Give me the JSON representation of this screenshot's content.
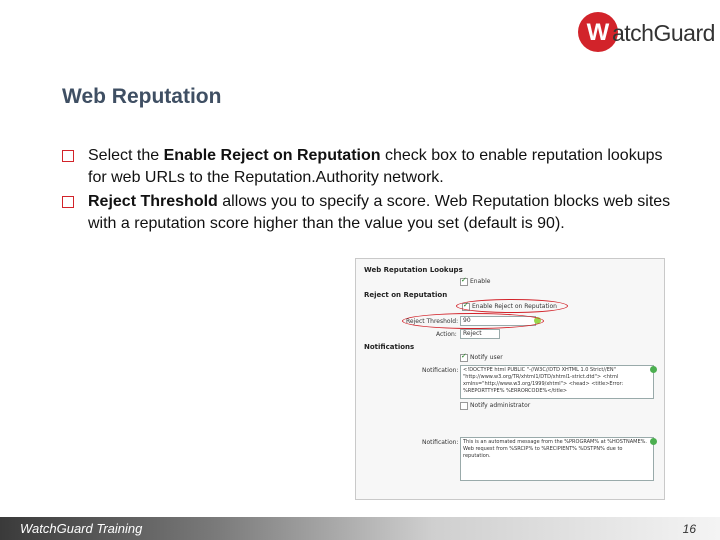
{
  "brand": {
    "logo_letter": "W",
    "logo_text": "atchGuard",
    "logo_color": "#d2232a"
  },
  "title": "Web Reputation",
  "bullets": [
    {
      "pre": "Select the ",
      "bold": "Enable Reject on Reputation",
      "post": " check box to enable reputation lookups for web URLs to the Reputation.Authority network."
    },
    {
      "pre": "",
      "bold": "Reject Threshold",
      "post": " allows you to specify a score. Web Reputation blocks web sites with a reputation score higher than the value you set (default is 90)."
    }
  ],
  "screenshot": {
    "section_lookups": "Web Reputation Lookups",
    "enable_label": "Enable",
    "section_reject": "Reject on Reputation",
    "enable_reject_label": "Enable Reject on Reputation",
    "threshold_label": "Reject Threshold:",
    "threshold_value": "90",
    "action_label": "Action:",
    "action_value": "Reject",
    "section_notifications": "Notifications",
    "notify_user_label": "Notify user",
    "notification_label": "Notification:",
    "notification_user_text": "<!DOCTYPE html PUBLIC \"-//W3C//DTD XHTML 1.0 Strict//EN\" \"http://www.w3.org/TR/xhtml1/DTD/xhtml1-strict.dtd\"> <html xmlns=\"http://www.w3.org/1999/xhtml\"> <head> <title>Error: %REPORTTYPE% %ERRORCODE%</title>",
    "notify_admin_label": "Notify administrator",
    "notification_admin_text": "This is an automated message from the %PROGRAM% at %HOSTNAME%. Web request from %SRCIP% to %RECIPIENT% %DSTPN% due to reputation."
  },
  "footer": {
    "left": "WatchGuard Training",
    "page": "16"
  }
}
